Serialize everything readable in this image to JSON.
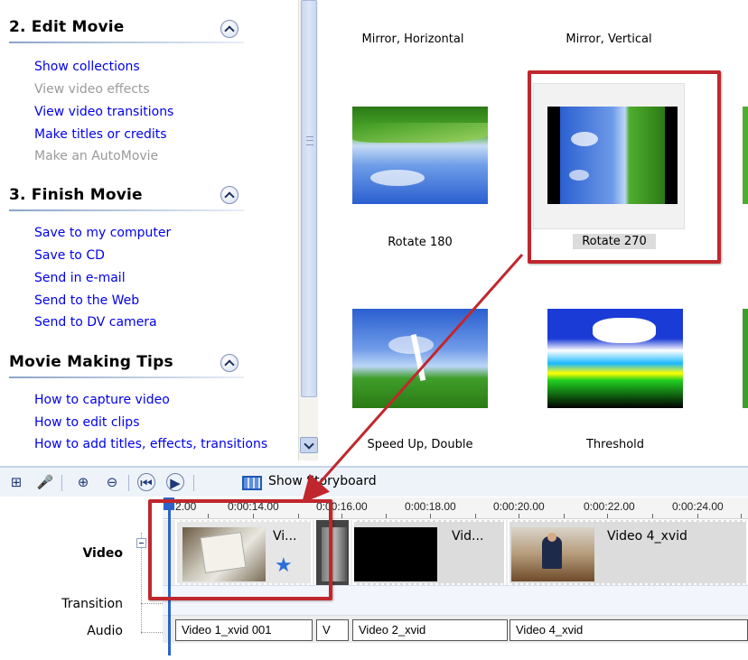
{
  "task_pane": {
    "sections": [
      {
        "title": "2. Edit Movie",
        "links": [
          {
            "label": "Show collections",
            "enabled": true
          },
          {
            "label": "View video effects",
            "enabled": false
          },
          {
            "label": "View video transitions",
            "enabled": true
          },
          {
            "label": "Make titles or credits",
            "enabled": true
          },
          {
            "label": "Make an AutoMovie",
            "enabled": false
          }
        ]
      },
      {
        "title": "3. Finish Movie",
        "links": [
          {
            "label": "Save to my computer",
            "enabled": true
          },
          {
            "label": "Save to CD",
            "enabled": true
          },
          {
            "label": "Send in e-mail",
            "enabled": true
          },
          {
            "label": "Send to the Web",
            "enabled": true
          },
          {
            "label": "Send to DV camera",
            "enabled": true
          }
        ]
      },
      {
        "title": "Movie Making Tips",
        "links": [
          {
            "label": "How to capture video",
            "enabled": true
          },
          {
            "label": "How to edit clips",
            "enabled": true
          },
          {
            "label": "How to add titles, effects, transitions",
            "enabled": true
          }
        ]
      }
    ]
  },
  "effects": {
    "row1_labels": [
      "Mirror, Horizontal",
      "Mirror, Vertical"
    ],
    "row2_labels": [
      "Rotate 180",
      "Rotate 270"
    ],
    "row3_labels": [
      "Speed Up, Double",
      "Threshold"
    ],
    "selected": "Rotate 270"
  },
  "toolbar": {
    "show_storyboard": "Show Storyboard"
  },
  "timeline": {
    "ruler_labels": [
      "2.00",
      "0:00:14.00",
      "0:00:16.00",
      "0:00:18.00",
      "0:00:20.00",
      "0:00:22.00",
      "0:00:24.00"
    ],
    "tracks": {
      "video": "Video",
      "transition": "Transition",
      "audio": "Audio"
    },
    "video_clips": [
      "Vi...",
      "Vid...",
      "Video 4_xvid"
    ],
    "audio_clips": [
      "Video 1_xvid 001",
      "V",
      "Video 2_xvid",
      "Video 4_xvid"
    ]
  },
  "colors": {
    "highlight_red": "#c0272d",
    "link_blue": "#0000ee",
    "disabled_gray": "#9a9a9a",
    "playhead_blue": "#2b64c8"
  }
}
